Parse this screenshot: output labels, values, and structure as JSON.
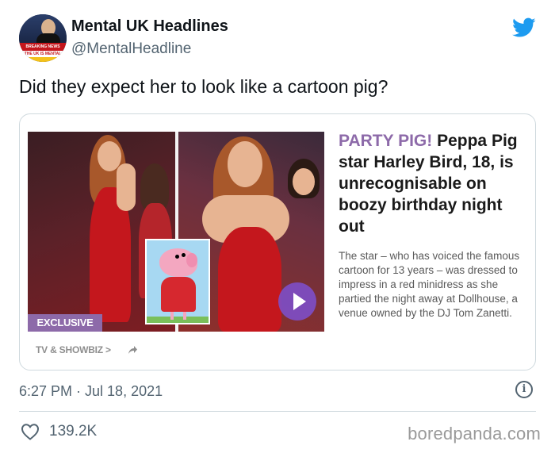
{
  "author": {
    "display_name": "Mental UK Headlines",
    "handle": "@MentalHeadline",
    "avatar_text": {
      "banner_top": "BREAKING NEWS",
      "banner_main": "THE UK IS MENTAL"
    }
  },
  "platform_icon": "twitter-bird-icon",
  "tweet": {
    "text": "Did they expect her to look like a cartoon pig?",
    "timestamp": "6:27 PM · Jul 18, 2021",
    "likes": "139.2K"
  },
  "article": {
    "kicker": "PARTY PIG!",
    "headline": "Peppa Pig star Harley Bird, 18, is unrecognisable on boozy birthday night out",
    "summary": "The star –  who has voiced the famous cartoon for 13 years – was dressed to impress in a red minidress as she partied the night away at Dollhouse, a venue owned by the DJ Tom Zanetti.",
    "badge": "EXCLUSIVE",
    "section": "TV & SHOWBIZ >"
  },
  "watermark": "boredpanda.com",
  "colors": {
    "twitter_blue": "#1d9bf0",
    "kicker_purple": "#8d6aa9",
    "secondary_text": "#536471"
  }
}
